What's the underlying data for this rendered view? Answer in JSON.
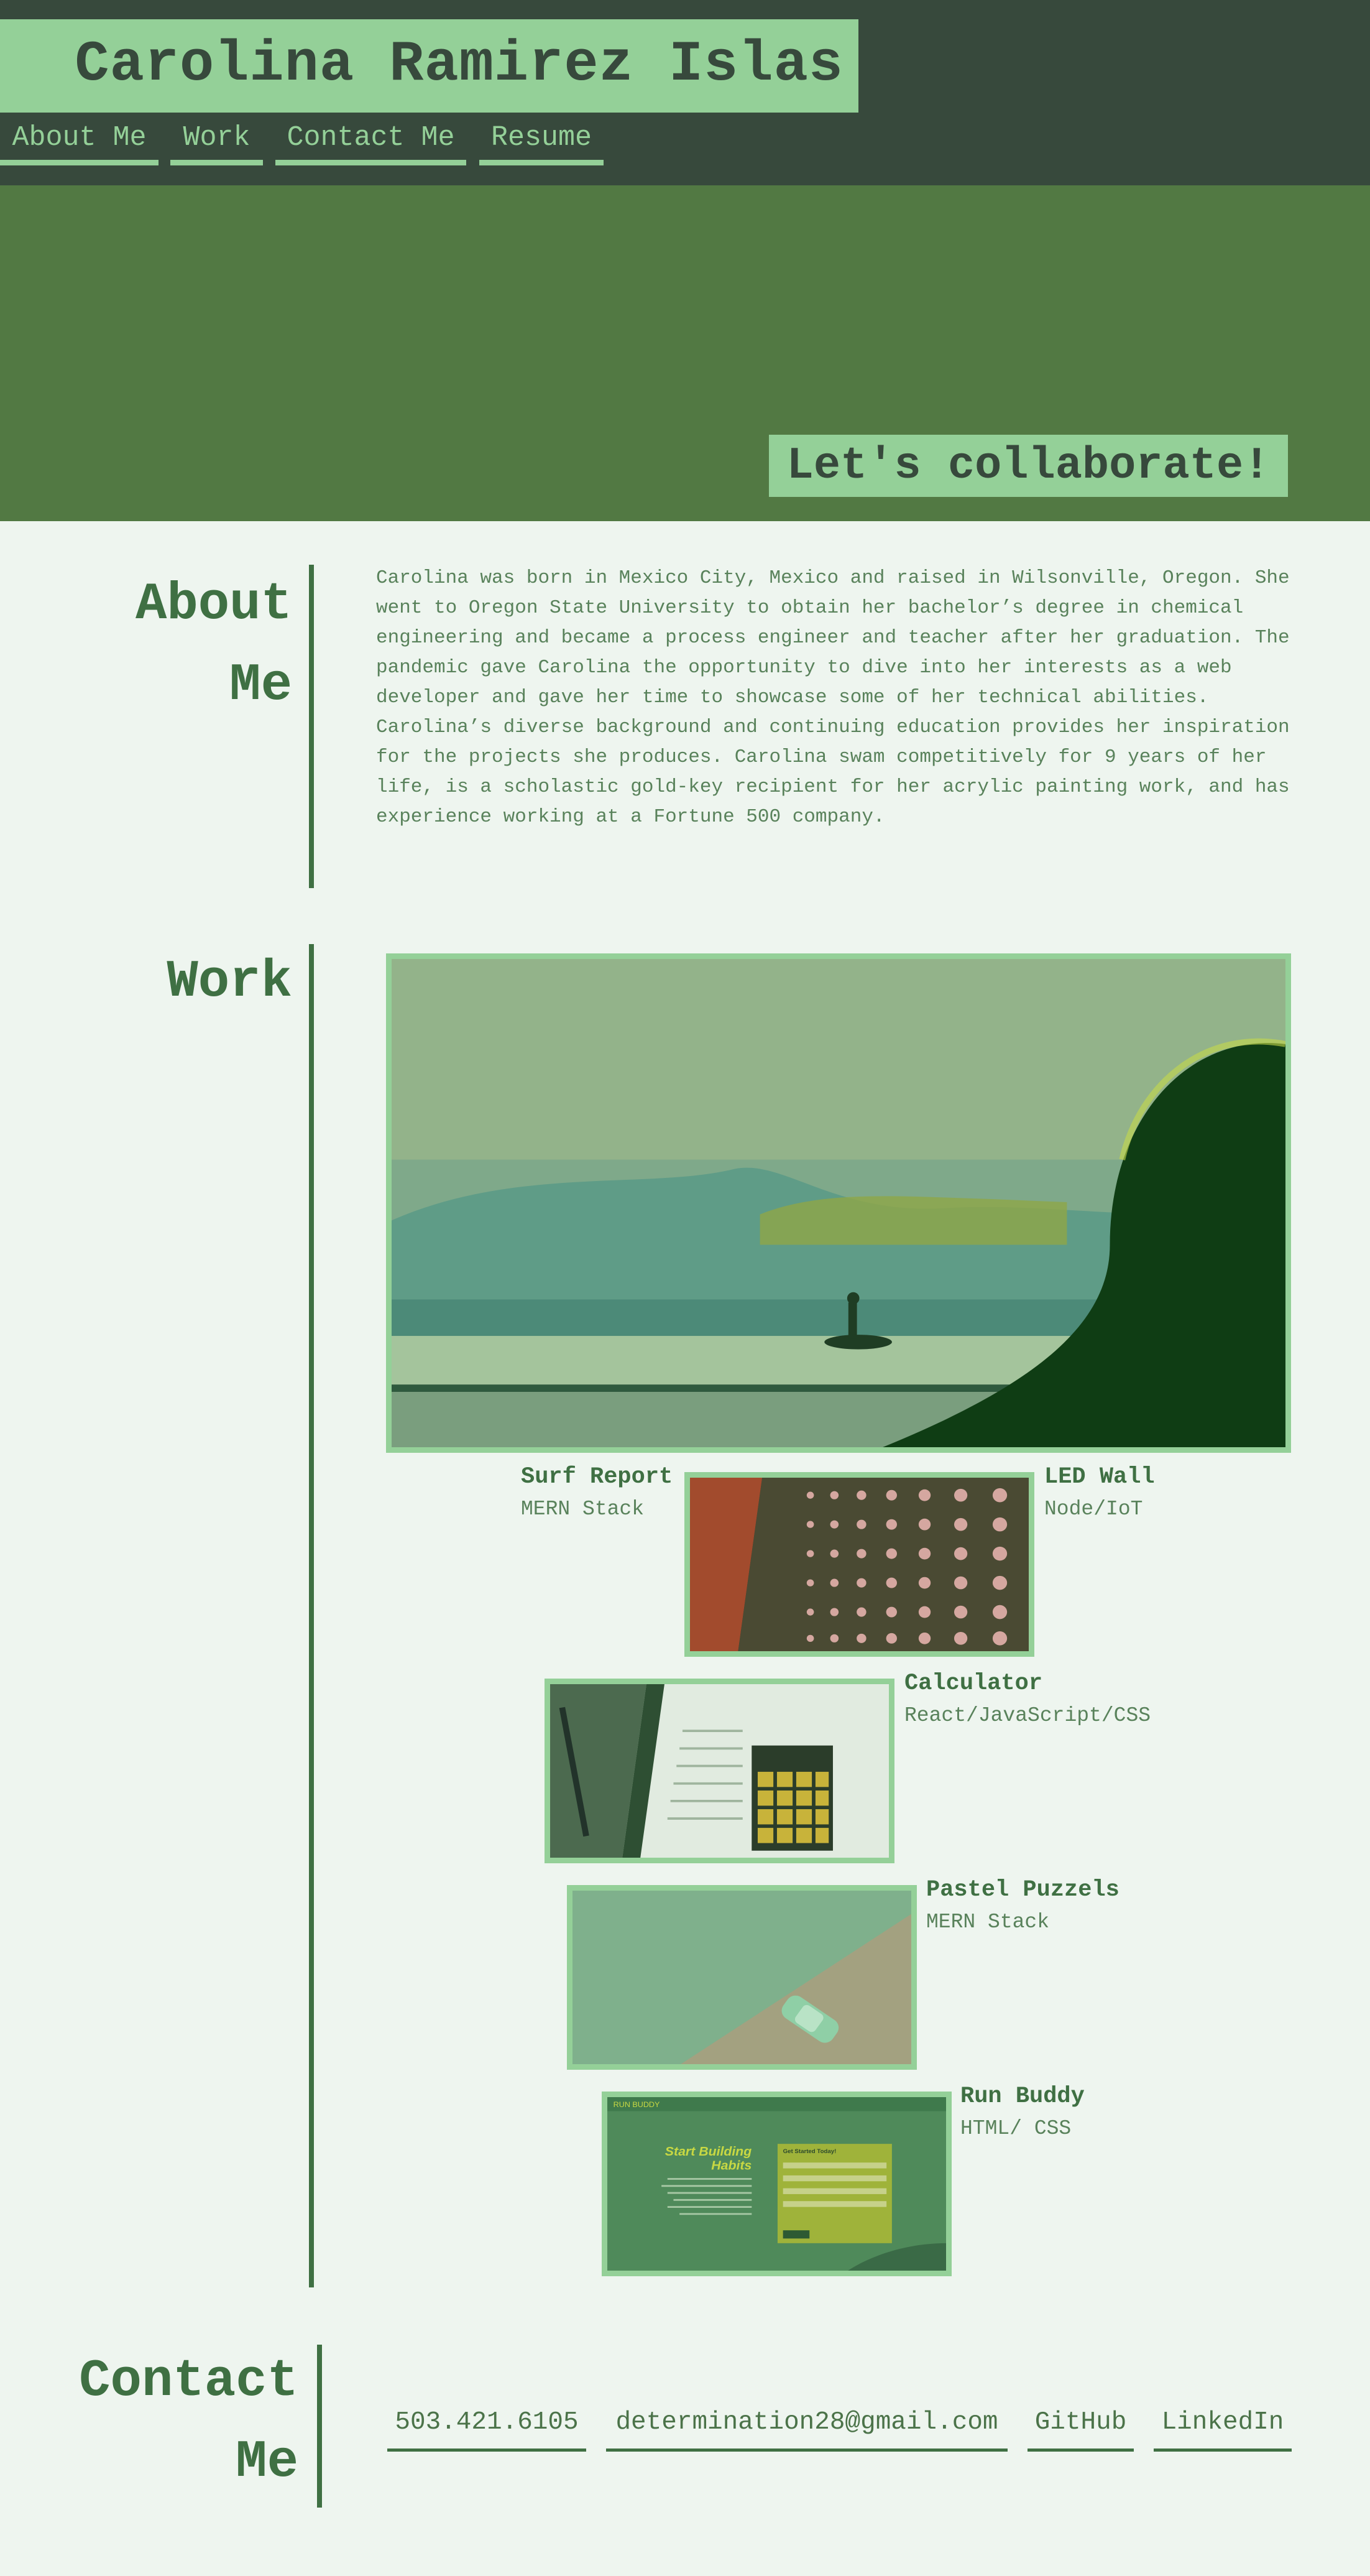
{
  "header": {
    "site_title": "Carolina Ramirez Islas",
    "nav": [
      {
        "label": "About Me"
      },
      {
        "label": "Work"
      },
      {
        "label": "Contact Me"
      },
      {
        "label": "Resume"
      }
    ]
  },
  "hero": {
    "cta": "Let's collaborate!"
  },
  "about": {
    "title_line1": "About",
    "title_line2": "Me",
    "text": "Carolina was born in Mexico City, Mexico and raised in Wilsonville, Oregon. She went to Oregon State University to obtain her bachelor’s degree in chemical engineering and became a process engineer and teacher after her graduation. The pandemic gave Carolina the opportunity to dive into her interests as a web developer and gave her time to showcase some of her technical abilities. Carolina’s diverse background and continuing education provides her inspiration for the projects she produces. Carolina swam competitively for 9 years of her life, is a scholastic gold-key recipient for her acrylic painting work, and has experience working at a Fortune 500 company."
  },
  "work": {
    "title": "Work",
    "projects": [
      {
        "name": "Surf Report",
        "tech": "MERN Stack",
        "image": "surfer-photo"
      },
      {
        "name": "LED Wall",
        "tech": "Node/IoT",
        "image": "led-wall-photo"
      },
      {
        "name": "Calculator",
        "tech": "React/JavaScript/CSS",
        "image": "calculator-photo"
      },
      {
        "name": "Pastel Puzzels",
        "tech": "MERN Stack",
        "image": "pastel-car-photo"
      },
      {
        "name": "Run Buddy",
        "tech": "HTML/ CSS",
        "image": "run-buddy-screenshot"
      }
    ],
    "run_buddy_shot": {
      "logo": "RUN BUDDY",
      "headline_1": "Start Building",
      "headline_2": "Habits",
      "form_title": "Get Started Today!"
    }
  },
  "contact": {
    "title_line1": "Contact",
    "title_line2": "Me",
    "links": [
      {
        "label": "503.421.6105"
      },
      {
        "label": "determination28@gmail.com"
      },
      {
        "label": "GitHub"
      },
      {
        "label": "LinkedIn"
      }
    ]
  },
  "colors": {
    "header_bg": "#37493c",
    "accent_green": "#94d098",
    "hero_bg": "#527943",
    "page_bg": "#eef5ef",
    "heading_green": "#3f7043",
    "body_text": "#59825b"
  }
}
